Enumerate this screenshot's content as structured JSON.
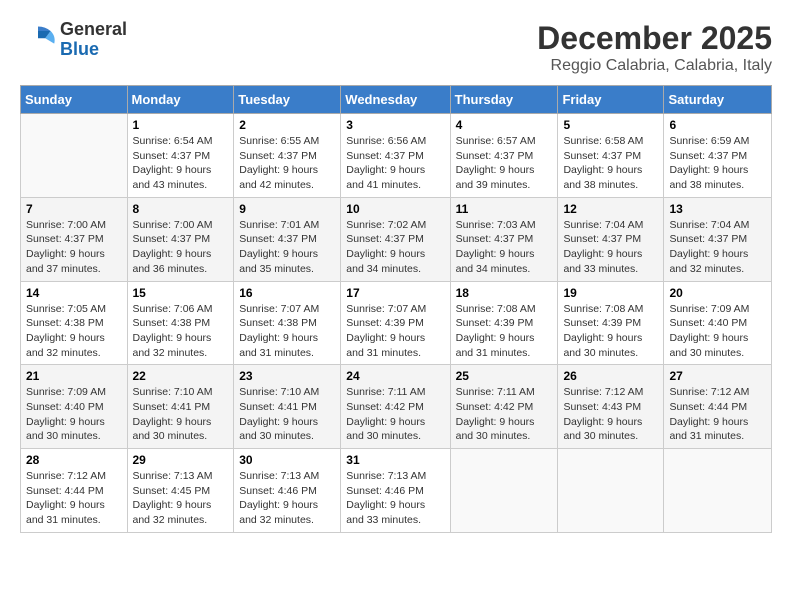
{
  "header": {
    "logo_general": "General",
    "logo_blue": "Blue",
    "month_title": "December 2025",
    "location": "Reggio Calabria, Calabria, Italy"
  },
  "days_of_week": [
    "Sunday",
    "Monday",
    "Tuesday",
    "Wednesday",
    "Thursday",
    "Friday",
    "Saturday"
  ],
  "weeks": [
    [
      {
        "day": "",
        "sunrise": "",
        "sunset": "",
        "daylight": ""
      },
      {
        "day": "1",
        "sunrise": "Sunrise: 6:54 AM",
        "sunset": "Sunset: 4:37 PM",
        "daylight": "Daylight: 9 hours and 43 minutes."
      },
      {
        "day": "2",
        "sunrise": "Sunrise: 6:55 AM",
        "sunset": "Sunset: 4:37 PM",
        "daylight": "Daylight: 9 hours and 42 minutes."
      },
      {
        "day": "3",
        "sunrise": "Sunrise: 6:56 AM",
        "sunset": "Sunset: 4:37 PM",
        "daylight": "Daylight: 9 hours and 41 minutes."
      },
      {
        "day": "4",
        "sunrise": "Sunrise: 6:57 AM",
        "sunset": "Sunset: 4:37 PM",
        "daylight": "Daylight: 9 hours and 39 minutes."
      },
      {
        "day": "5",
        "sunrise": "Sunrise: 6:58 AM",
        "sunset": "Sunset: 4:37 PM",
        "daylight": "Daylight: 9 hours and 38 minutes."
      },
      {
        "day": "6",
        "sunrise": "Sunrise: 6:59 AM",
        "sunset": "Sunset: 4:37 PM",
        "daylight": "Daylight: 9 hours and 38 minutes."
      }
    ],
    [
      {
        "day": "7",
        "sunrise": "Sunrise: 7:00 AM",
        "sunset": "Sunset: 4:37 PM",
        "daylight": "Daylight: 9 hours and 37 minutes."
      },
      {
        "day": "8",
        "sunrise": "Sunrise: 7:00 AM",
        "sunset": "Sunset: 4:37 PM",
        "daylight": "Daylight: 9 hours and 36 minutes."
      },
      {
        "day": "9",
        "sunrise": "Sunrise: 7:01 AM",
        "sunset": "Sunset: 4:37 PM",
        "daylight": "Daylight: 9 hours and 35 minutes."
      },
      {
        "day": "10",
        "sunrise": "Sunrise: 7:02 AM",
        "sunset": "Sunset: 4:37 PM",
        "daylight": "Daylight: 9 hours and 34 minutes."
      },
      {
        "day": "11",
        "sunrise": "Sunrise: 7:03 AM",
        "sunset": "Sunset: 4:37 PM",
        "daylight": "Daylight: 9 hours and 34 minutes."
      },
      {
        "day": "12",
        "sunrise": "Sunrise: 7:04 AM",
        "sunset": "Sunset: 4:37 PM",
        "daylight": "Daylight: 9 hours and 33 minutes."
      },
      {
        "day": "13",
        "sunrise": "Sunrise: 7:04 AM",
        "sunset": "Sunset: 4:37 PM",
        "daylight": "Daylight: 9 hours and 32 minutes."
      }
    ],
    [
      {
        "day": "14",
        "sunrise": "Sunrise: 7:05 AM",
        "sunset": "Sunset: 4:38 PM",
        "daylight": "Daylight: 9 hours and 32 minutes."
      },
      {
        "day": "15",
        "sunrise": "Sunrise: 7:06 AM",
        "sunset": "Sunset: 4:38 PM",
        "daylight": "Daylight: 9 hours and 32 minutes."
      },
      {
        "day": "16",
        "sunrise": "Sunrise: 7:07 AM",
        "sunset": "Sunset: 4:38 PM",
        "daylight": "Daylight: 9 hours and 31 minutes."
      },
      {
        "day": "17",
        "sunrise": "Sunrise: 7:07 AM",
        "sunset": "Sunset: 4:39 PM",
        "daylight": "Daylight: 9 hours and 31 minutes."
      },
      {
        "day": "18",
        "sunrise": "Sunrise: 7:08 AM",
        "sunset": "Sunset: 4:39 PM",
        "daylight": "Daylight: 9 hours and 31 minutes."
      },
      {
        "day": "19",
        "sunrise": "Sunrise: 7:08 AM",
        "sunset": "Sunset: 4:39 PM",
        "daylight": "Daylight: 9 hours and 30 minutes."
      },
      {
        "day": "20",
        "sunrise": "Sunrise: 7:09 AM",
        "sunset": "Sunset: 4:40 PM",
        "daylight": "Daylight: 9 hours and 30 minutes."
      }
    ],
    [
      {
        "day": "21",
        "sunrise": "Sunrise: 7:09 AM",
        "sunset": "Sunset: 4:40 PM",
        "daylight": "Daylight: 9 hours and 30 minutes."
      },
      {
        "day": "22",
        "sunrise": "Sunrise: 7:10 AM",
        "sunset": "Sunset: 4:41 PM",
        "daylight": "Daylight: 9 hours and 30 minutes."
      },
      {
        "day": "23",
        "sunrise": "Sunrise: 7:10 AM",
        "sunset": "Sunset: 4:41 PM",
        "daylight": "Daylight: 9 hours and 30 minutes."
      },
      {
        "day": "24",
        "sunrise": "Sunrise: 7:11 AM",
        "sunset": "Sunset: 4:42 PM",
        "daylight": "Daylight: 9 hours and 30 minutes."
      },
      {
        "day": "25",
        "sunrise": "Sunrise: 7:11 AM",
        "sunset": "Sunset: 4:42 PM",
        "daylight": "Daylight: 9 hours and 30 minutes."
      },
      {
        "day": "26",
        "sunrise": "Sunrise: 7:12 AM",
        "sunset": "Sunset: 4:43 PM",
        "daylight": "Daylight: 9 hours and 30 minutes."
      },
      {
        "day": "27",
        "sunrise": "Sunrise: 7:12 AM",
        "sunset": "Sunset: 4:44 PM",
        "daylight": "Daylight: 9 hours and 31 minutes."
      }
    ],
    [
      {
        "day": "28",
        "sunrise": "Sunrise: 7:12 AM",
        "sunset": "Sunset: 4:44 PM",
        "daylight": "Daylight: 9 hours and 31 minutes."
      },
      {
        "day": "29",
        "sunrise": "Sunrise: 7:13 AM",
        "sunset": "Sunset: 4:45 PM",
        "daylight": "Daylight: 9 hours and 32 minutes."
      },
      {
        "day": "30",
        "sunrise": "Sunrise: 7:13 AM",
        "sunset": "Sunset: 4:46 PM",
        "daylight": "Daylight: 9 hours and 32 minutes."
      },
      {
        "day": "31",
        "sunrise": "Sunrise: 7:13 AM",
        "sunset": "Sunset: 4:46 PM",
        "daylight": "Daylight: 9 hours and 33 minutes."
      },
      {
        "day": "",
        "sunrise": "",
        "sunset": "",
        "daylight": ""
      },
      {
        "day": "",
        "sunrise": "",
        "sunset": "",
        "daylight": ""
      },
      {
        "day": "",
        "sunrise": "",
        "sunset": "",
        "daylight": ""
      }
    ]
  ]
}
